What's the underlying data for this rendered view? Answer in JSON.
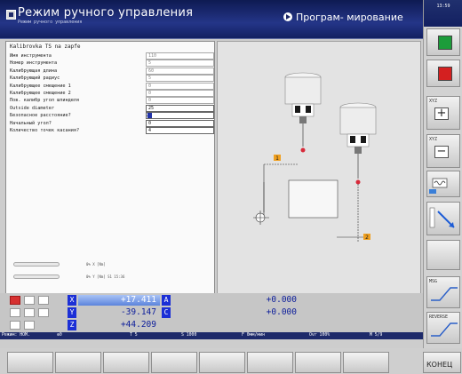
{
  "header": {
    "mode_title": "Режим ручного управления",
    "mode_subtitle": "Режим ручного управления",
    "program_label": "Програм- мирование"
  },
  "clock": "13:59",
  "form": {
    "title": "Kalibrovka TS na zapfe",
    "rows": [
      {
        "label": "Имя инструмента",
        "value": "110"
      },
      {
        "label": "Номер инструмента",
        "value": "5"
      },
      {
        "label": "Калибрующая длина",
        "value": "60"
      },
      {
        "label": "Калибрующий радиус",
        "value": "5"
      },
      {
        "label": "Калибрующее смещение 1",
        "value": "0"
      },
      {
        "label": "Калибрующее смещение 2",
        "value": "0"
      },
      {
        "label": "Пов. калибр угол шпинделя",
        "value": "0"
      },
      {
        "label": "Outside diameter",
        "value": "25"
      },
      {
        "label": "Безопасное расстояние?",
        "value": "2"
      },
      {
        "label": "Начальный угол?",
        "value": "0"
      },
      {
        "label": "Количество точек касания?",
        "value": "4"
      }
    ],
    "status1": "0% X [Nm]",
    "status2": "0% Y [Nm]  S1  15:36"
  },
  "graphic": {
    "marker1": "1",
    "marker2": "2"
  },
  "positions": [
    {
      "axis": "X",
      "value": "+17.411"
    },
    {
      "axis": "Y",
      "value": "-39.147"
    },
    {
      "axis": "Z",
      "value": "+44.209"
    },
    {
      "axis": "A",
      "value": "+0.000"
    },
    {
      "axis": "C",
      "value": "+0.000"
    }
  ],
  "status_bar": {
    "mode": "Режим: НОМ.",
    "datum": "⊕0",
    "tool": "T 5",
    "spindle": "S 1000",
    "feed": "F 0мм/мин",
    "override": "Ovr 100%",
    "mfunc": "M 5/9"
  },
  "right_softkeys": {
    "xyz1": "XYZ",
    "xyz2": "XYZ",
    "keybox1": "MSG",
    "keybox2": "REVERSE"
  },
  "bottom_softkeys": {
    "end_label": "КОНЕЦ"
  },
  "colors": {
    "header": "#1e2a6a",
    "axis": "#1b2fd6",
    "active_value": "#5b84dc"
  }
}
